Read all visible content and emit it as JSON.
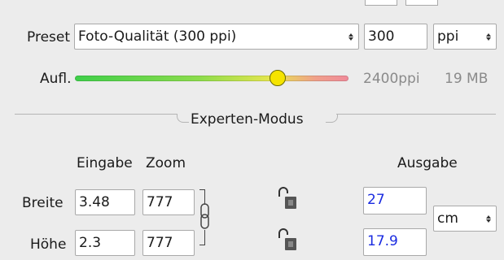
{
  "preset": {
    "label": "Preset",
    "selected": "Foto-Qualität (300 ppi)",
    "resolution_value": "300",
    "unit_selected": "ppi"
  },
  "resolution": {
    "label": "Aufl.",
    "slider_fraction": 0.74,
    "ppi_text": "2400ppi",
    "size_text": "19 MB"
  },
  "section": {
    "title": "Experten-Modus"
  },
  "columns": {
    "input": "Eingabe",
    "zoom": "Zoom",
    "output": "Ausgabe"
  },
  "rows": [
    {
      "label": "Breite",
      "input": "3.48",
      "zoom": "777",
      "output": "27"
    },
    {
      "label": "Höhe",
      "input": "2.3",
      "zoom": "777",
      "output": "17.9"
    }
  ],
  "output_unit": "cm",
  "colors": {
    "background": "#ececec",
    "output_text": "#1a2be0",
    "slider_knob": "#f5e400",
    "slider_start": "#3fcf4a",
    "slider_end": "#f08a9a"
  },
  "icons": {
    "lock": "padlock-open-icon",
    "chain": "chain-link-icon",
    "stepper": "up-down-arrows-icon"
  }
}
